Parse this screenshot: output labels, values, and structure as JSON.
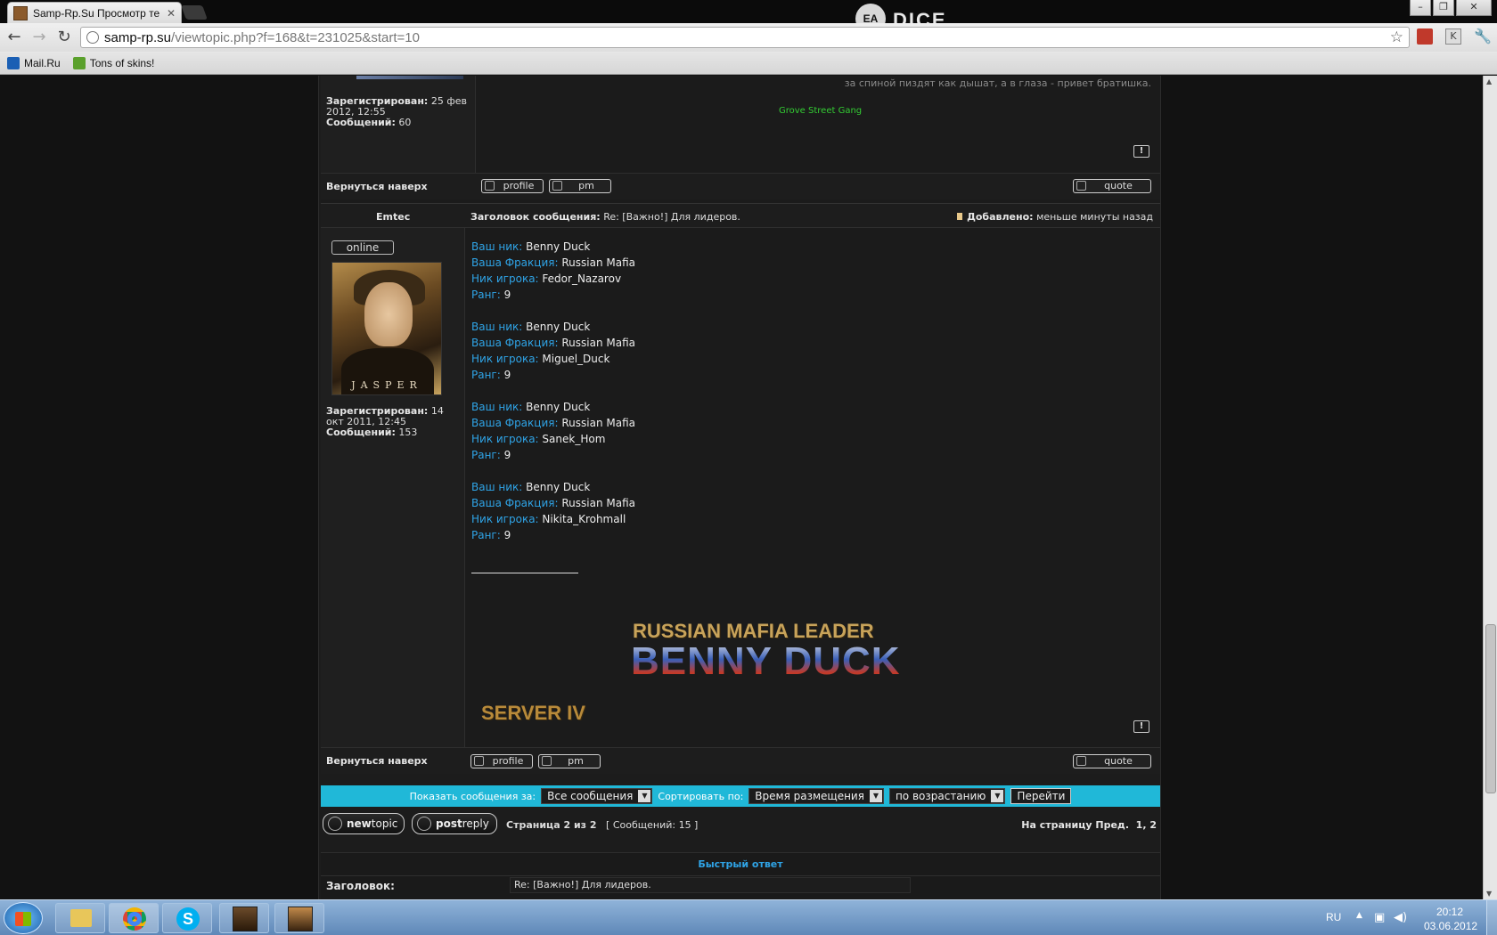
{
  "browser": {
    "tab_title": "Samp-Rp.Su Просмотр те",
    "url_host": "samp-rp.su",
    "url_path": "/viewtopic.php?f=168&t=231025&start=10",
    "bookmarks": [
      {
        "label": "Mail.Ru",
        "icon": "mail-icon"
      },
      {
        "label": "Tons of skins!",
        "icon": "bookmark-icon"
      }
    ],
    "brand_ea": "EA",
    "brand_dice": "DICE"
  },
  "post1": {
    "signature_quote": "за спиной пиздят как дышат, а в глаза - привет братишка.",
    "gang": "Grove Street Gang",
    "registered_label": "Зарегистрирован:",
    "registered_value": "25 фев 2012, 12:55",
    "posts_label": "Сообщений:",
    "posts_value": "60"
  },
  "post2": {
    "author": "Emtec",
    "subject_label": "Заголовок сообщения:",
    "subject_value": "Re: [Важно!] Для лидеров.",
    "added_label": "Добавлено:",
    "added_value": "меньше минуты назад",
    "status": "online",
    "avatar_caption": "JASPER",
    "registered_label": "Зарегистрирован:",
    "registered_value": "14 окт 2011, 12:45",
    "posts_label": "Сообщений:",
    "posts_value": "153",
    "labels": {
      "nick": "Ваш ник:",
      "faction": "Ваша Фракция:",
      "player": "Ник игрока:",
      "rank": "Ранг:"
    },
    "entries": [
      {
        "nick": "Benny Duck",
        "faction": "Russian Mafia",
        "player": "Fedor_Nazarov",
        "rank": "9"
      },
      {
        "nick": "Benny Duck",
        "faction": "Russian Mafia",
        "player": "Miguel_Duck",
        "rank": "9"
      },
      {
        "nick": "Benny Duck",
        "faction": "Russian Mafia",
        "player": "Sanek_Hom",
        "rank": "9"
      },
      {
        "nick": "Benny Duck",
        "faction": "Russian Mafia",
        "player": "Nikita_Krohmall",
        "rank": "9"
      }
    ],
    "sig_line1": "RUSSIAN MAFIA LEADER",
    "sig_line2": "BENNY DUCK",
    "sig_line3": "SERVER IV"
  },
  "actions": {
    "back_to_top": "Вернуться наверх",
    "profile": "profile",
    "pm": "pm",
    "quote": "quote",
    "report": "!"
  },
  "sortbar": {
    "show_label": "Показать сообщения за:",
    "show_value": "Все сообщения",
    "sort_label": "Сортировать по:",
    "sort_value": "Время размещения",
    "order_value": "по возрастанию",
    "go": "Перейти"
  },
  "pagination": {
    "newtopic_a": "new",
    "newtopic_b": "topic",
    "postreply_a": "post",
    "postreply_b": "reply",
    "page_info": "Страница 2 из 2",
    "messages": "[ Сообщений: 15 ]",
    "goto_label": "На страницу",
    "prev": "Пред.",
    "pages": "1, 2"
  },
  "quickreply": {
    "title": "Быстрый ответ",
    "subject_label": "Заголовок:",
    "subject_value": "Re: [Важно!] Для лидеров."
  },
  "taskbar": {
    "lang": "RU",
    "time": "20:12",
    "date": "03.06.2012"
  },
  "colors": {
    "accent_cyan": "#20b8d8",
    "field_label_blue": "#2fa4e7",
    "gang_green": "#33cc33"
  }
}
